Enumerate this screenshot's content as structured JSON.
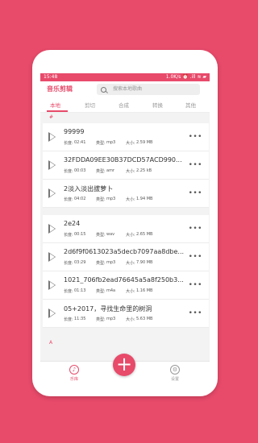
{
  "status": {
    "time": "15:48",
    "right": "1.0K/s  ⏰  .ill  ≋  ▰"
  },
  "header": {
    "title": "音乐剪辑",
    "search_placeholder": "搜索本地歌曲"
  },
  "tabs": [
    {
      "label": "本地",
      "active": true
    },
    {
      "label": "剪切",
      "active": false
    },
    {
      "label": "合成",
      "active": false
    },
    {
      "label": "转换",
      "active": false
    },
    {
      "label": "其他",
      "active": false
    }
  ],
  "sections": [
    {
      "letter": "#"
    },
    {
      "letter": "A"
    }
  ],
  "labels": {
    "duration": "长度:",
    "type": "类型:",
    "size": "大小:"
  },
  "group1": [
    {
      "name": "99999",
      "duration": "02:41",
      "type": "mp3",
      "size": "2.59 MB"
    },
    {
      "name": "32FDDA09EE30B37DCD57ACD990...",
      "duration": "00:03",
      "type": "amr",
      "size": "2.25 kB"
    },
    {
      "name": "2淡入淡出拔萝卜",
      "duration": "04:02",
      "type": "mp3",
      "size": "1.94 MB"
    }
  ],
  "group2": [
    {
      "name": "2e24",
      "duration": "00:15",
      "type": "wav",
      "size": "2.65 MB"
    },
    {
      "name": "2d6f9f0613023a5decb7097aa8dbe...",
      "duration": "03:29",
      "type": "mp3",
      "size": "7.90 MB"
    },
    {
      "name": "1021_706fb2ead76645a5a8f250b3...",
      "duration": "01:13",
      "type": "m4a",
      "size": "1.16 MB"
    },
    {
      "name": "05+2017，寻找生命里的树洞",
      "duration": "11:35",
      "type": "mp3",
      "size": "5.63 MB"
    }
  ],
  "more_glyph": "•••",
  "bottom_nav": {
    "library": "乐库",
    "settings": "设置",
    "add": "+"
  },
  "colors": {
    "accent": "#e84a6a",
    "background": "#e84a6a"
  }
}
